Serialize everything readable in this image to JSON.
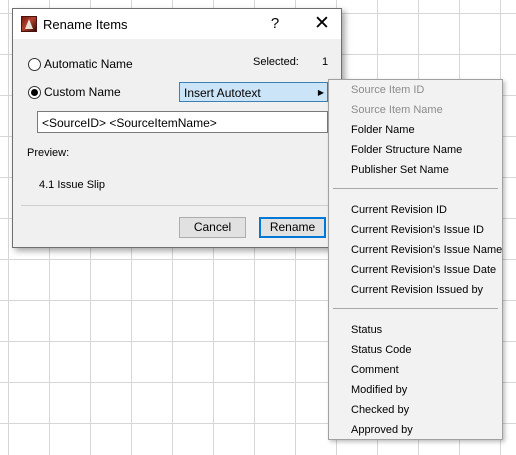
{
  "dialog": {
    "title": "Rename Items",
    "help_glyph": "?",
    "close_glyph": "✕",
    "automatic_name_label": "Automatic Name",
    "custom_name_label": "Custom Name",
    "selected_label": "Selected:",
    "selected_count": "1",
    "insert_autotext_label": "Insert Autotext",
    "insert_autotext_arrow": "▶",
    "name_field_value": "<SourceID> <SourceItemName>",
    "preview_label": "Preview:",
    "preview_value": "4.1 Issue Slip",
    "cancel_label": "Cancel",
    "rename_label": "Rename",
    "selected_option": "custom"
  },
  "menu": {
    "groups": [
      [
        {
          "label": "Source Item ID",
          "disabled": true
        },
        {
          "label": "Source Item Name",
          "disabled": true
        },
        {
          "label": "Folder Name",
          "disabled": false
        },
        {
          "label": "Folder Structure Name",
          "disabled": false
        },
        {
          "label": "Publisher Set Name",
          "disabled": false
        }
      ],
      [
        {
          "label": "Current Revision ID",
          "disabled": false
        },
        {
          "label": "Current Revision's Issue ID",
          "disabled": false
        },
        {
          "label": "Current Revision's Issue Name",
          "disabled": false
        },
        {
          "label": "Current Revision's Issue Date",
          "disabled": false
        },
        {
          "label": "Current Revision Issued by",
          "disabled": false
        }
      ],
      [
        {
          "label": "Status",
          "disabled": false
        },
        {
          "label": "Status Code",
          "disabled": false
        },
        {
          "label": "Comment",
          "disabled": false
        },
        {
          "label": "Modified by",
          "disabled": false
        },
        {
          "label": "Checked by",
          "disabled": false
        },
        {
          "label": "Approved by",
          "disabled": false
        }
      ]
    ]
  },
  "colors": {
    "accent": "#0078d7",
    "hover_bg": "#cce4f7",
    "disabled_text": "#8c8c8c"
  }
}
